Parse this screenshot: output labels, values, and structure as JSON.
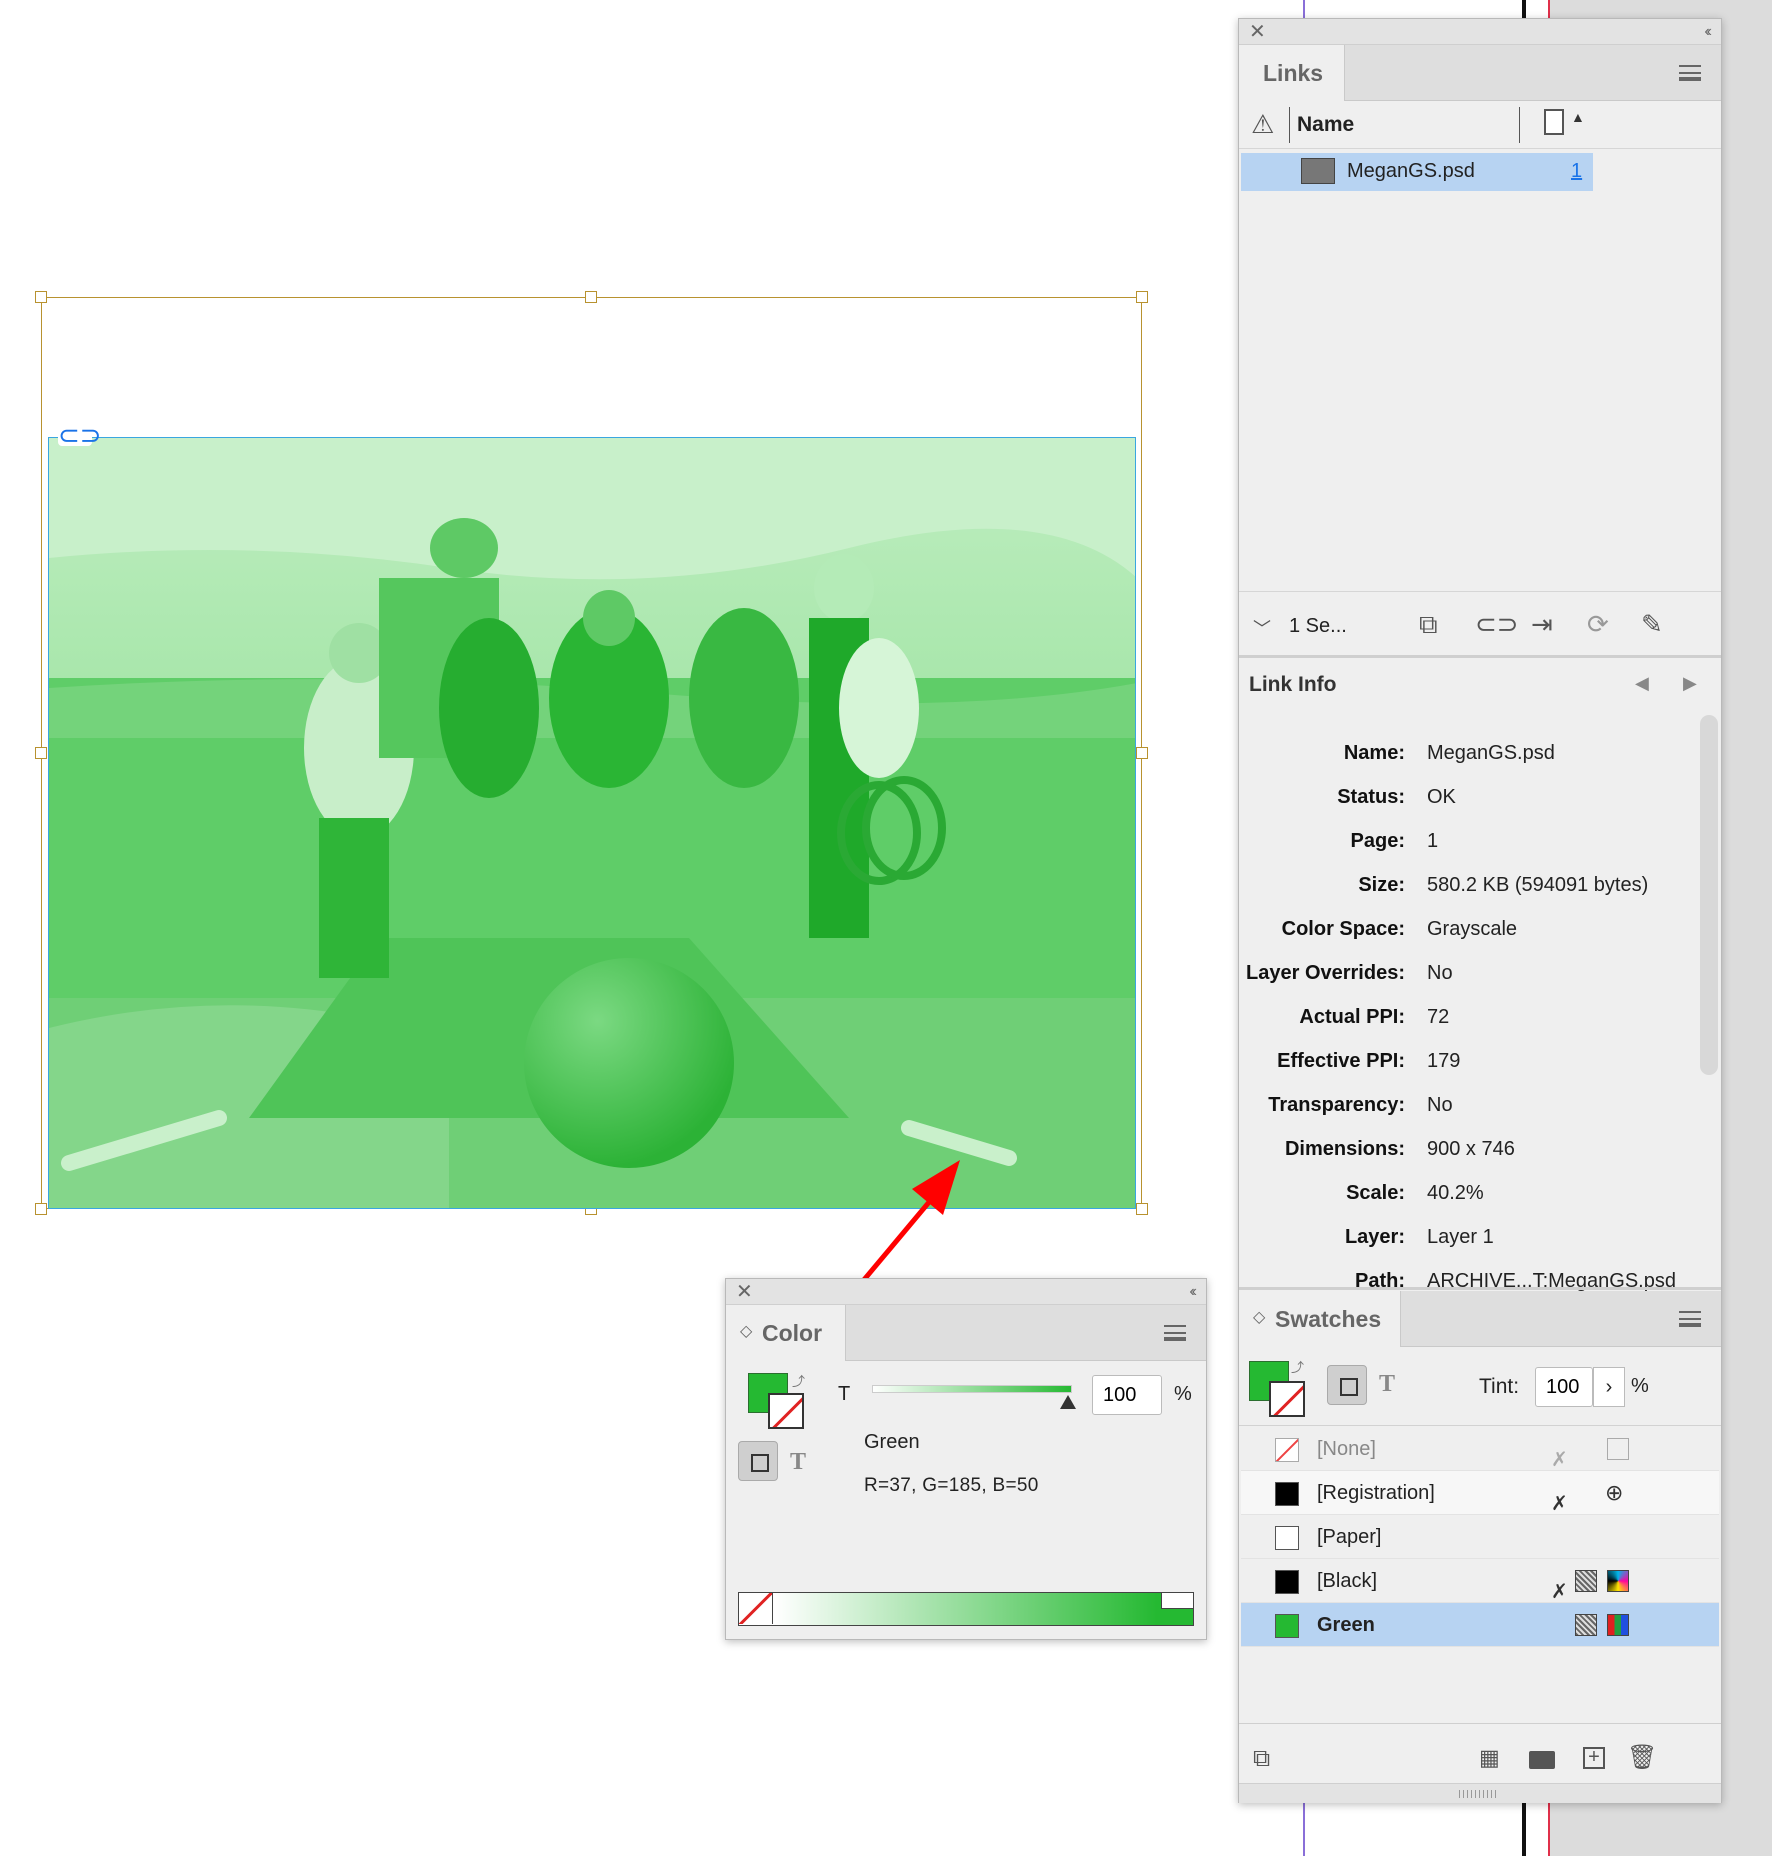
{
  "colors": {
    "accent_green": "#25b932",
    "selection_blue": "#b7d3f2",
    "frame_gold": "#b8922f",
    "link_blue": "#1a73e8",
    "arrow_red": "#ff0000"
  },
  "canvas": {
    "image_description_icon": "link-icon"
  },
  "links_panel": {
    "tab_label": "Links",
    "header_name": "Name",
    "file_name": "MeganGS.psd",
    "page_link": "1",
    "footer_status": "1 Se...",
    "link_info": {
      "title": "Link Info",
      "rows": [
        {
          "label": "Name:",
          "value": "MeganGS.psd"
        },
        {
          "label": "Status:",
          "value": "OK"
        },
        {
          "label": "Page:",
          "value": "1"
        },
        {
          "label": "Size:",
          "value": "580.2 KB (594091 bytes)"
        },
        {
          "label": "Color Space:",
          "value": "Grayscale"
        },
        {
          "label": "Layer Overrides:",
          "value": "No"
        },
        {
          "label": "Actual PPI:",
          "value": "72"
        },
        {
          "label": "Effective PPI:",
          "value": "179"
        },
        {
          "label": "Transparency:",
          "value": "No"
        },
        {
          "label": "Dimensions:",
          "value": "900 x 746"
        },
        {
          "label": "Scale:",
          "value": "40.2%"
        },
        {
          "label": "Layer:",
          "value": "Layer 1"
        },
        {
          "label": "Path:",
          "value": "ARCHIVE...T:MeganGS.psd"
        }
      ]
    }
  },
  "swatches_panel": {
    "tab_label": "Swatches",
    "tint_label": "Tint:",
    "tint_value": "100",
    "percent": "%",
    "items": [
      {
        "name": "[None]",
        "chip": "none"
      },
      {
        "name": "[Registration]",
        "chip": "#000000"
      },
      {
        "name": "[Paper]",
        "chip": "#ffffff"
      },
      {
        "name": "[Black]",
        "chip": "#000000"
      },
      {
        "name": "Green",
        "chip": "#25b932",
        "selected": true
      }
    ]
  },
  "color_panel": {
    "tab_label": "Color",
    "slider_label": "T",
    "tint_value": "100",
    "percent": "%",
    "swatch_name": "Green",
    "rgb_text": "R=37, G=185, B=50"
  }
}
